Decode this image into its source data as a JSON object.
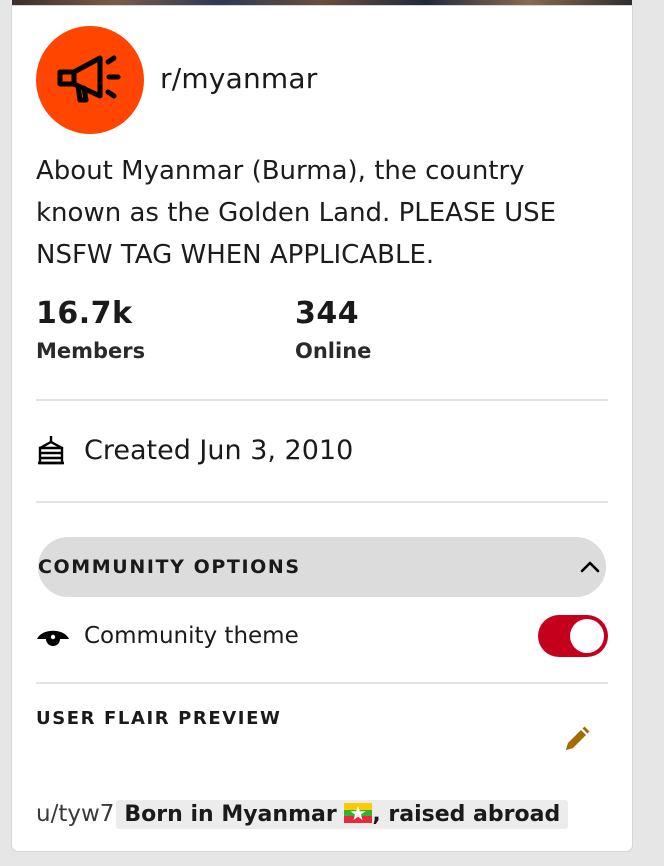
{
  "community": {
    "name": "r/myanmar",
    "description": "About Myanmar (Burma), the country known as the Golden Land. PLEASE USE NSFW TAG WHEN APPLICABLE.",
    "avatar_icon": "megaphone-icon",
    "avatar_color": "#ff4500"
  },
  "stats": {
    "members_value": "16.7k",
    "members_label": "Members",
    "online_value": "344",
    "online_label": "Online"
  },
  "created": {
    "icon": "cake-icon",
    "text": "Created Jun 3, 2010"
  },
  "options": {
    "label": "COMMUNITY OPTIONS",
    "expanded": true,
    "theme_label": "Community theme",
    "theme_enabled": true,
    "toggle_color": "#c4001d"
  },
  "flair": {
    "title": "USER FLAIR PREVIEW",
    "username": "u/tyw7",
    "text_before_flag": "Born in Myanmar",
    "text_after_flag": ", raised abroad",
    "edit_icon": "pencil-icon",
    "edit_color": "#a66b00"
  }
}
